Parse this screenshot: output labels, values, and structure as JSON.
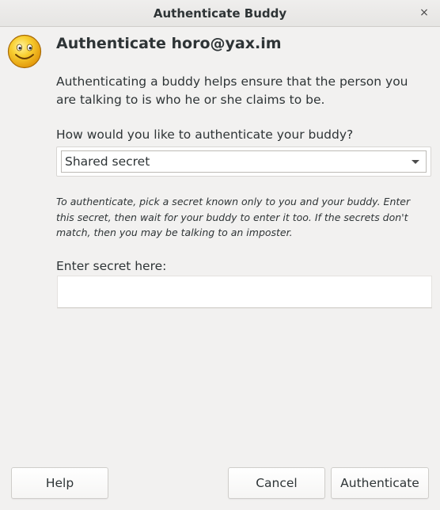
{
  "window": {
    "title": "Authenticate Buddy",
    "close_glyph": "×"
  },
  "header": {
    "icon": "smiley-face-icon",
    "title": "Authenticate horo@yax.im"
  },
  "description": "Authenticating a buddy helps ensure that the person you are talking to is who he or she claims to be.",
  "method": {
    "question": "How would you like to authenticate your buddy?",
    "selected": "Shared secret"
  },
  "instructions": "To authenticate, pick a secret known only to you and your buddy.  Enter this secret, then wait for your buddy to enter it too.  If the secrets don't match, then you may be talking to an imposter.",
  "secret": {
    "label": "Enter secret here:",
    "value": ""
  },
  "buttons": {
    "help": "Help",
    "cancel": "Cancel",
    "authenticate": "Authenticate"
  },
  "colors": {
    "background": "#f2f1f0",
    "text": "#2e3436",
    "smiley_face": "#f7c51e"
  }
}
